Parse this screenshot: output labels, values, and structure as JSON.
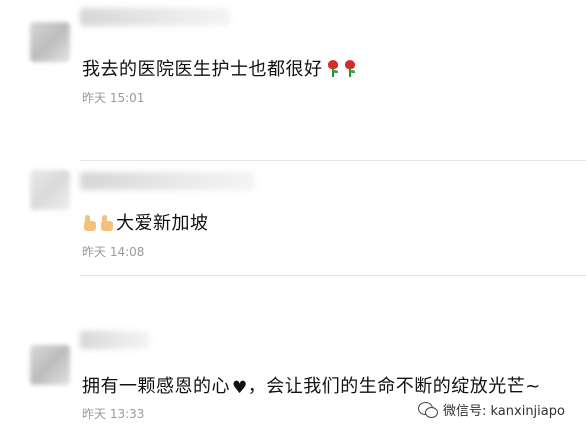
{
  "comments": [
    {
      "content": "我去的医院医生护士也都很好",
      "emoji": [
        "rose-emoji",
        "rose-emoji"
      ],
      "time": "昨天 15:01"
    },
    {
      "content": "大爱新加坡",
      "emoji_prefix": [
        "thumbs-up-emoji",
        "thumbs-up-emoji"
      ],
      "time": "昨天 14:08"
    },
    {
      "content_before": "拥有一颗感恩的心",
      "heart": "♥",
      "content_after": "，会让我们的生命不断的绽放光芒~",
      "time": "昨天 13:33"
    }
  ],
  "watermark": {
    "text": "微信号: kanxinjiapo",
    "icon": "wechat-icon"
  }
}
